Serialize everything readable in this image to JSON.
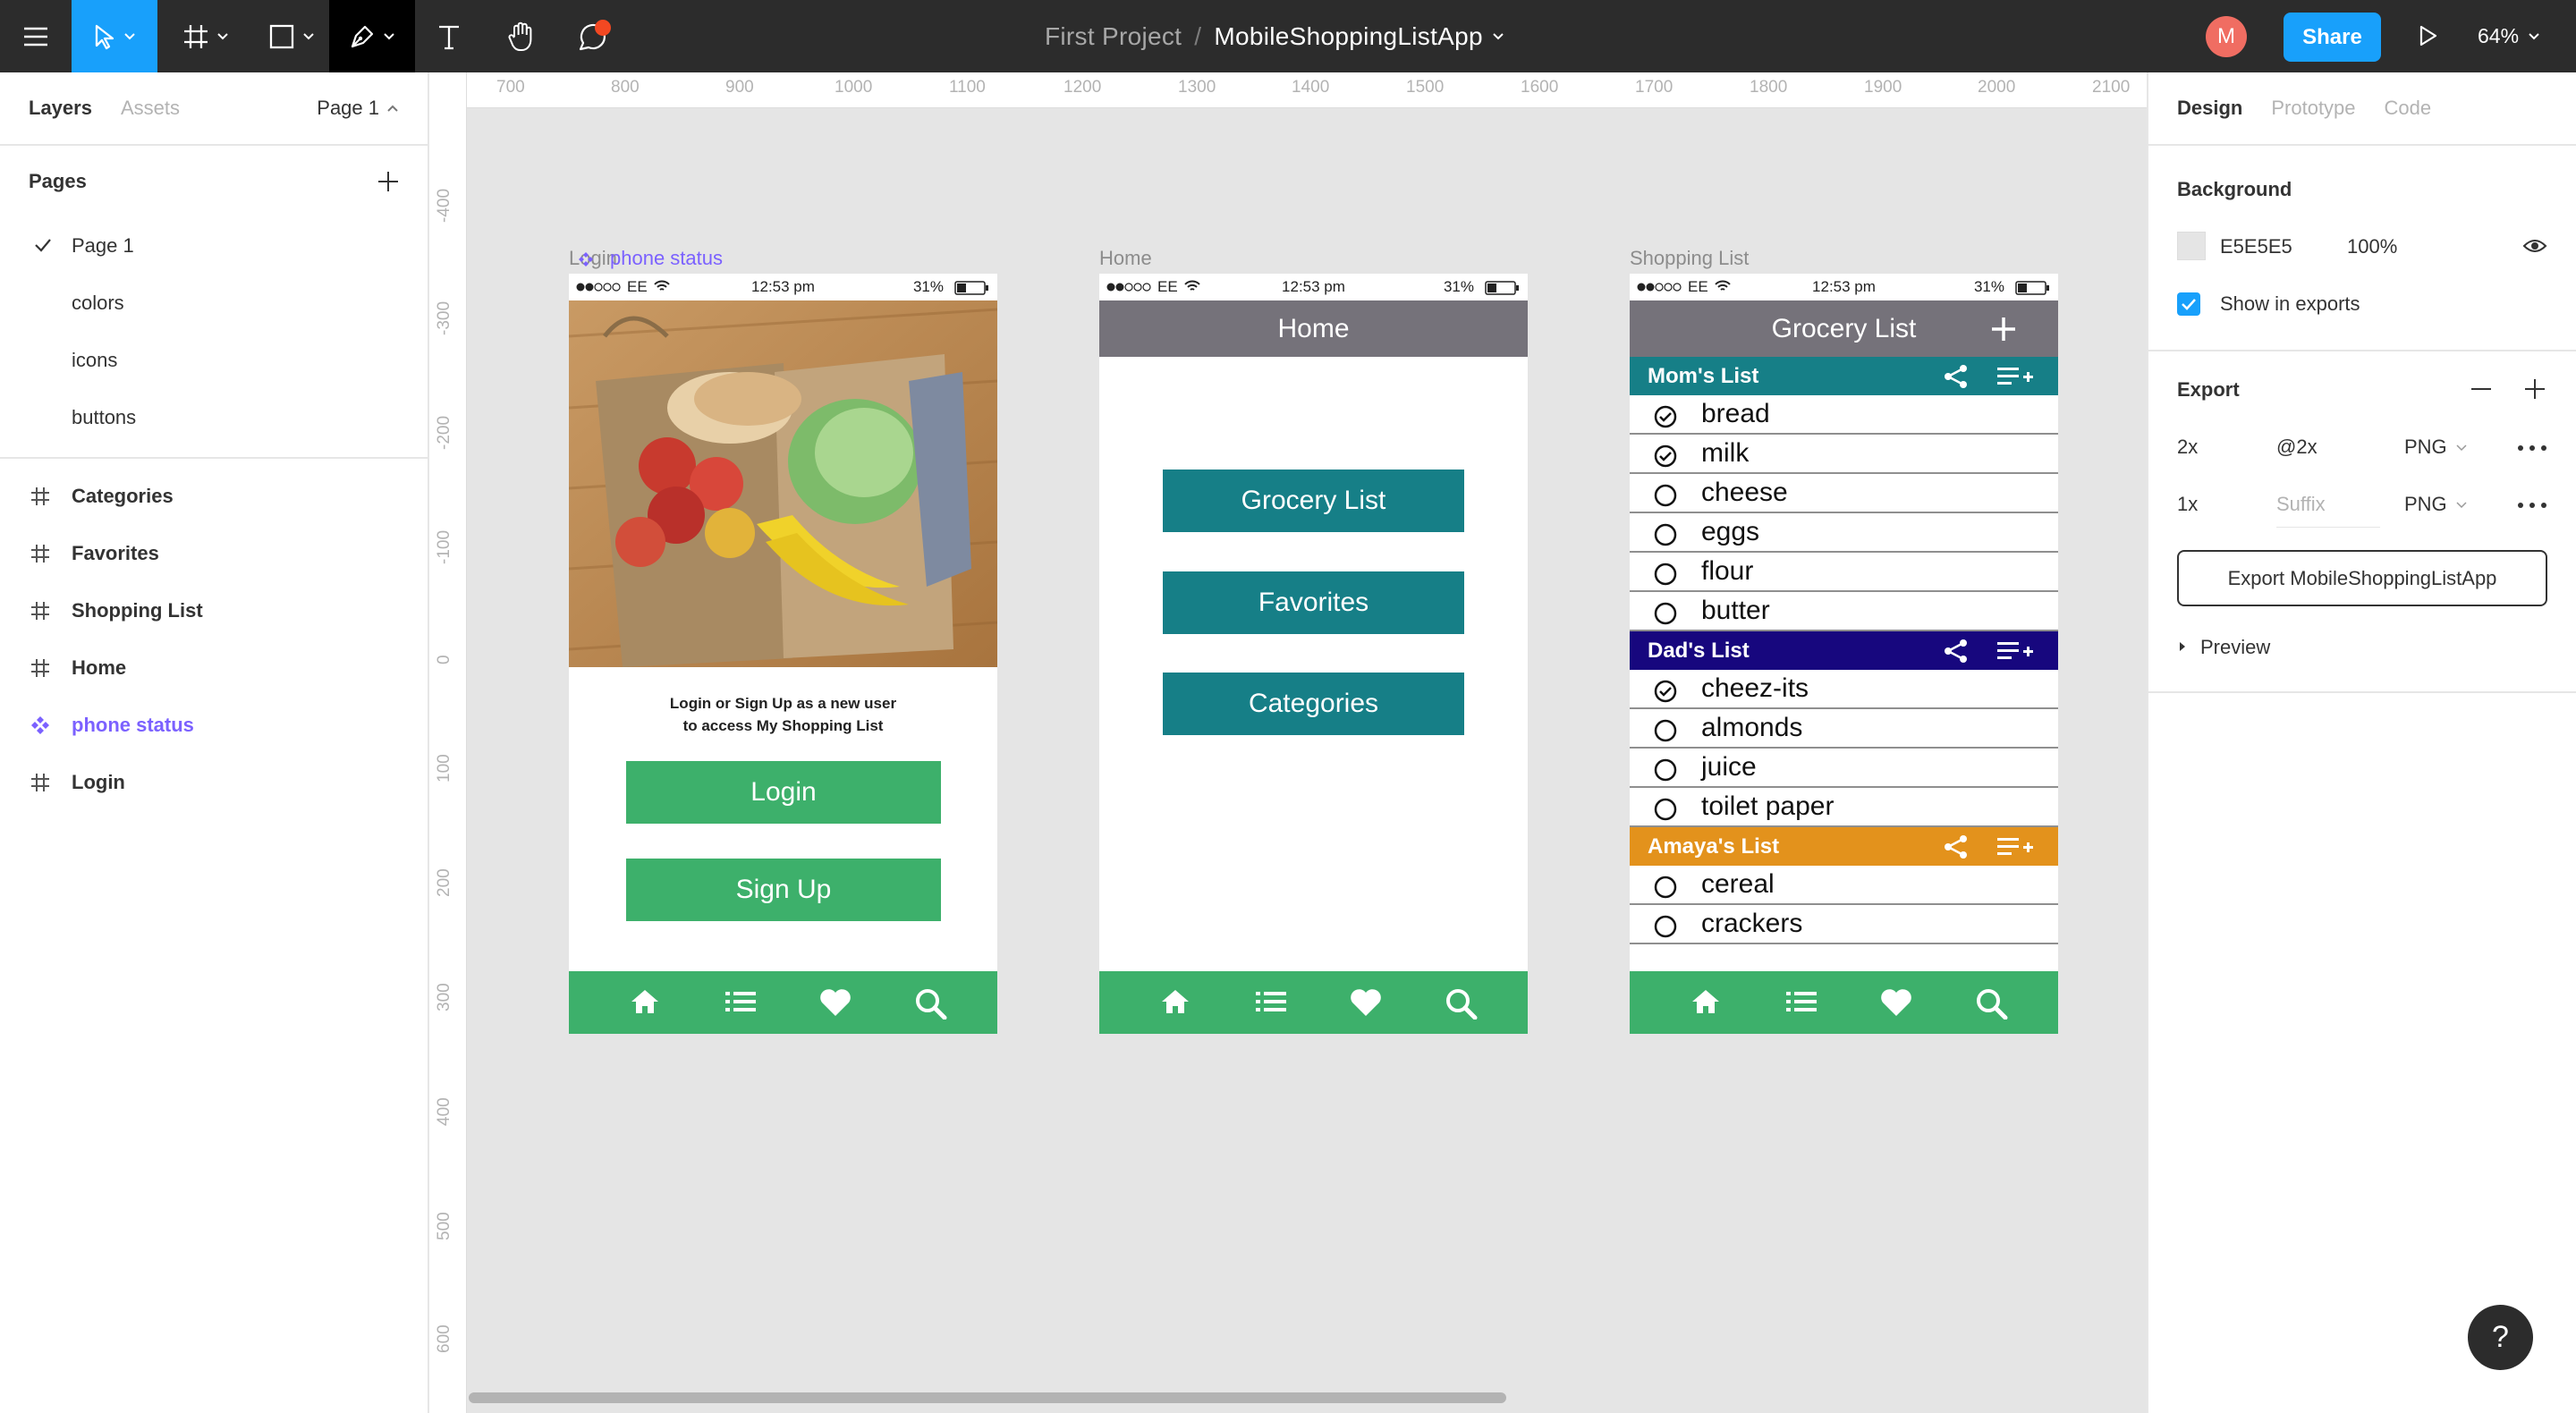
{
  "toolbar": {
    "project": "First Project",
    "separator": "/",
    "file_name": "MobileShoppingListApp",
    "avatar_initial": "M",
    "share_label": "Share",
    "zoom": "64%",
    "accent": "#18a0fb"
  },
  "left_panel": {
    "tab_layers": "Layers",
    "tab_assets": "Assets",
    "current_page": "Page 1",
    "pages_heading": "Pages",
    "pages": [
      "Page 1",
      "colors",
      "icons",
      "buttons"
    ],
    "layers": [
      "Categories",
      "Favorites",
      "Shopping List",
      "Home",
      "phone status",
      "Login"
    ]
  },
  "canvas": {
    "ruler_top": [
      "700",
      "800",
      "900",
      "1000",
      "1100",
      "1200",
      "1300",
      "1400",
      "1500",
      "1600",
      "1700",
      "1800",
      "1900",
      "2000",
      "2100"
    ],
    "ruler_left": [
      "-400",
      "-300",
      "-200",
      "-100",
      "0",
      "100",
      "200",
      "300",
      "400",
      "500",
      "600"
    ],
    "frames": {
      "login": {
        "label_a": "Login",
        "label_b": "phone status",
        "message_1": "Login or Sign Up as a new user",
        "message_2": "to access My Shopping List",
        "login_label": "Login",
        "signup_label": "Sign Up"
      },
      "home": {
        "label": "Home",
        "title": "Home",
        "buttons": [
          "Grocery List",
          "Favorites",
          "Categories"
        ]
      },
      "shopping": {
        "label": "Shopping List",
        "title": "Grocery List",
        "lists": [
          {
            "name": "Mom's List",
            "color": "#167f87",
            "items": [
              {
                "t": "bread",
                "c": true
              },
              {
                "t": "milk",
                "c": true
              },
              {
                "t": "cheese",
                "c": false
              },
              {
                "t": "eggs",
                "c": false
              },
              {
                "t": "flour",
                "c": false
              },
              {
                "t": "butter",
                "c": false
              }
            ]
          },
          {
            "name": "Dad's List",
            "color": "#17077e",
            "items": [
              {
                "t": "cheez-its",
                "c": true
              },
              {
                "t": "almonds",
                "c": false
              },
              {
                "t": "juice",
                "c": false
              },
              {
                "t": "toilet paper",
                "c": false
              }
            ]
          },
          {
            "name": "Amaya's List",
            "color": "#e3921c",
            "items": [
              {
                "t": "cereal",
                "c": false
              },
              {
                "t": "crackers",
                "c": false
              }
            ]
          }
        ]
      },
      "status_bar": {
        "carrier": "EE",
        "time": "12:53 pm",
        "battery": "31%"
      }
    }
  },
  "right_panel": {
    "tab_design": "Design",
    "tab_prototype": "Prototype",
    "tab_code": "Code",
    "background_heading": "Background",
    "bg_hex": "E5E5E5",
    "bg_opacity": "100%",
    "show_in_exports": "Show in exports",
    "export_heading": "Export",
    "export_rows": [
      {
        "scale": "2x",
        "suffix": "@2x",
        "format": "PNG"
      },
      {
        "scale": "1x",
        "suffix_placeholder": "Suffix",
        "format": "PNG"
      }
    ],
    "export_button": "Export MobileShoppingListApp",
    "preview": "Preview"
  },
  "help": "?"
}
